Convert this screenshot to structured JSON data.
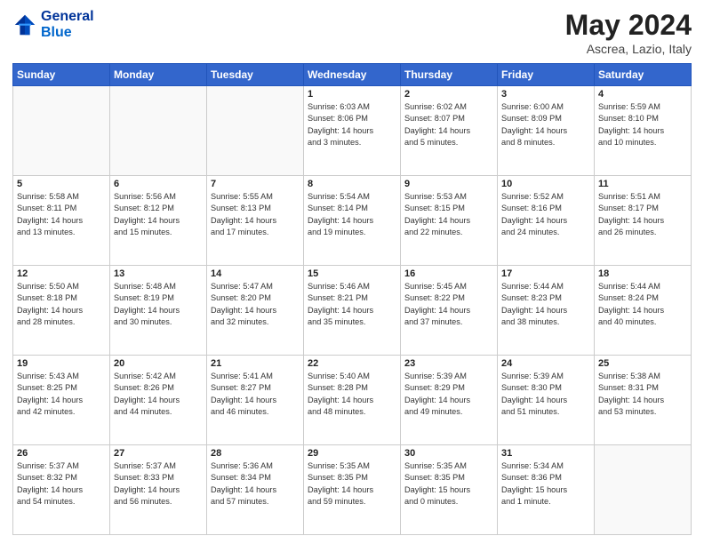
{
  "logo": {
    "line1": "General",
    "line2": "Blue"
  },
  "header": {
    "month": "May 2024",
    "location": "Ascrea, Lazio, Italy"
  },
  "weekdays": [
    "Sunday",
    "Monday",
    "Tuesday",
    "Wednesday",
    "Thursday",
    "Friday",
    "Saturday"
  ],
  "weeks": [
    [
      {
        "day": "",
        "info": "",
        "empty": true
      },
      {
        "day": "",
        "info": "",
        "empty": true
      },
      {
        "day": "",
        "info": "",
        "empty": true
      },
      {
        "day": "1",
        "info": "Sunrise: 6:03 AM\nSunset: 8:06 PM\nDaylight: 14 hours\nand 3 minutes."
      },
      {
        "day": "2",
        "info": "Sunrise: 6:02 AM\nSunset: 8:07 PM\nDaylight: 14 hours\nand 5 minutes."
      },
      {
        "day": "3",
        "info": "Sunrise: 6:00 AM\nSunset: 8:09 PM\nDaylight: 14 hours\nand 8 minutes."
      },
      {
        "day": "4",
        "info": "Sunrise: 5:59 AM\nSunset: 8:10 PM\nDaylight: 14 hours\nand 10 minutes."
      }
    ],
    [
      {
        "day": "5",
        "info": "Sunrise: 5:58 AM\nSunset: 8:11 PM\nDaylight: 14 hours\nand 13 minutes."
      },
      {
        "day": "6",
        "info": "Sunrise: 5:56 AM\nSunset: 8:12 PM\nDaylight: 14 hours\nand 15 minutes."
      },
      {
        "day": "7",
        "info": "Sunrise: 5:55 AM\nSunset: 8:13 PM\nDaylight: 14 hours\nand 17 minutes."
      },
      {
        "day": "8",
        "info": "Sunrise: 5:54 AM\nSunset: 8:14 PM\nDaylight: 14 hours\nand 19 minutes."
      },
      {
        "day": "9",
        "info": "Sunrise: 5:53 AM\nSunset: 8:15 PM\nDaylight: 14 hours\nand 22 minutes."
      },
      {
        "day": "10",
        "info": "Sunrise: 5:52 AM\nSunset: 8:16 PM\nDaylight: 14 hours\nand 24 minutes."
      },
      {
        "day": "11",
        "info": "Sunrise: 5:51 AM\nSunset: 8:17 PM\nDaylight: 14 hours\nand 26 minutes."
      }
    ],
    [
      {
        "day": "12",
        "info": "Sunrise: 5:50 AM\nSunset: 8:18 PM\nDaylight: 14 hours\nand 28 minutes."
      },
      {
        "day": "13",
        "info": "Sunrise: 5:48 AM\nSunset: 8:19 PM\nDaylight: 14 hours\nand 30 minutes."
      },
      {
        "day": "14",
        "info": "Sunrise: 5:47 AM\nSunset: 8:20 PM\nDaylight: 14 hours\nand 32 minutes."
      },
      {
        "day": "15",
        "info": "Sunrise: 5:46 AM\nSunset: 8:21 PM\nDaylight: 14 hours\nand 35 minutes."
      },
      {
        "day": "16",
        "info": "Sunrise: 5:45 AM\nSunset: 8:22 PM\nDaylight: 14 hours\nand 37 minutes."
      },
      {
        "day": "17",
        "info": "Sunrise: 5:44 AM\nSunset: 8:23 PM\nDaylight: 14 hours\nand 38 minutes."
      },
      {
        "day": "18",
        "info": "Sunrise: 5:44 AM\nSunset: 8:24 PM\nDaylight: 14 hours\nand 40 minutes."
      }
    ],
    [
      {
        "day": "19",
        "info": "Sunrise: 5:43 AM\nSunset: 8:25 PM\nDaylight: 14 hours\nand 42 minutes."
      },
      {
        "day": "20",
        "info": "Sunrise: 5:42 AM\nSunset: 8:26 PM\nDaylight: 14 hours\nand 44 minutes."
      },
      {
        "day": "21",
        "info": "Sunrise: 5:41 AM\nSunset: 8:27 PM\nDaylight: 14 hours\nand 46 minutes."
      },
      {
        "day": "22",
        "info": "Sunrise: 5:40 AM\nSunset: 8:28 PM\nDaylight: 14 hours\nand 48 minutes."
      },
      {
        "day": "23",
        "info": "Sunrise: 5:39 AM\nSunset: 8:29 PM\nDaylight: 14 hours\nand 49 minutes."
      },
      {
        "day": "24",
        "info": "Sunrise: 5:39 AM\nSunset: 8:30 PM\nDaylight: 14 hours\nand 51 minutes."
      },
      {
        "day": "25",
        "info": "Sunrise: 5:38 AM\nSunset: 8:31 PM\nDaylight: 14 hours\nand 53 minutes."
      }
    ],
    [
      {
        "day": "26",
        "info": "Sunrise: 5:37 AM\nSunset: 8:32 PM\nDaylight: 14 hours\nand 54 minutes."
      },
      {
        "day": "27",
        "info": "Sunrise: 5:37 AM\nSunset: 8:33 PM\nDaylight: 14 hours\nand 56 minutes."
      },
      {
        "day": "28",
        "info": "Sunrise: 5:36 AM\nSunset: 8:34 PM\nDaylight: 14 hours\nand 57 minutes."
      },
      {
        "day": "29",
        "info": "Sunrise: 5:35 AM\nSunset: 8:35 PM\nDaylight: 14 hours\nand 59 minutes."
      },
      {
        "day": "30",
        "info": "Sunrise: 5:35 AM\nSunset: 8:35 PM\nDaylight: 15 hours\nand 0 minutes."
      },
      {
        "day": "31",
        "info": "Sunrise: 5:34 AM\nSunset: 8:36 PM\nDaylight: 15 hours\nand 1 minute."
      },
      {
        "day": "",
        "info": "",
        "empty": true
      }
    ]
  ]
}
